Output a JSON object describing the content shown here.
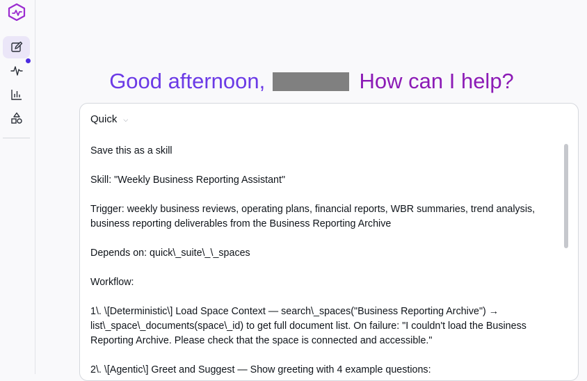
{
  "sidebar": {
    "logo": "app-logo",
    "items": [
      {
        "name": "compose",
        "icon": "edit-icon",
        "active": true
      },
      {
        "name": "activity",
        "icon": "pulse-icon",
        "active": false,
        "notification": true
      },
      {
        "name": "analytics",
        "icon": "bar-chart-icon",
        "active": false
      },
      {
        "name": "extensions",
        "icon": "shapes-icon",
        "active": false
      }
    ]
  },
  "greeting": {
    "prefix": "Good afternoon,",
    "suffix": "How can I help?"
  },
  "composer": {
    "mode": "Quick",
    "lines": [
      "Save this as a skill",
      "Skill: \"Weekly Business Reporting Assistant\"",
      "Trigger: weekly business reviews, operating plans, financial reports, WBR summaries, trend analysis, business reporting deliverables from the Business Reporting Archive",
      "Depends on: quick\\_suite\\_\\_spaces",
      "Workflow:",
      "1\\. \\[Deterministic\\] Load Space Context — search\\_spaces(\"Business Reporting Archive\") → list\\_space\\_documents(space\\_id) to get full document list. On failure: \"I couldn't load the Business Reporting Archive. Please check that the space is connected and accessible.\"",
      "2\\. \\[Agentic\\] Greet and Suggest — Show greeting with 4 example questions:"
    ]
  },
  "colors": {
    "greeting_purple": "#6b3ae6",
    "greeting_magenta": "#8c1bb6",
    "active_bg": "#ebe6f8",
    "notification": "#4b2be0"
  }
}
